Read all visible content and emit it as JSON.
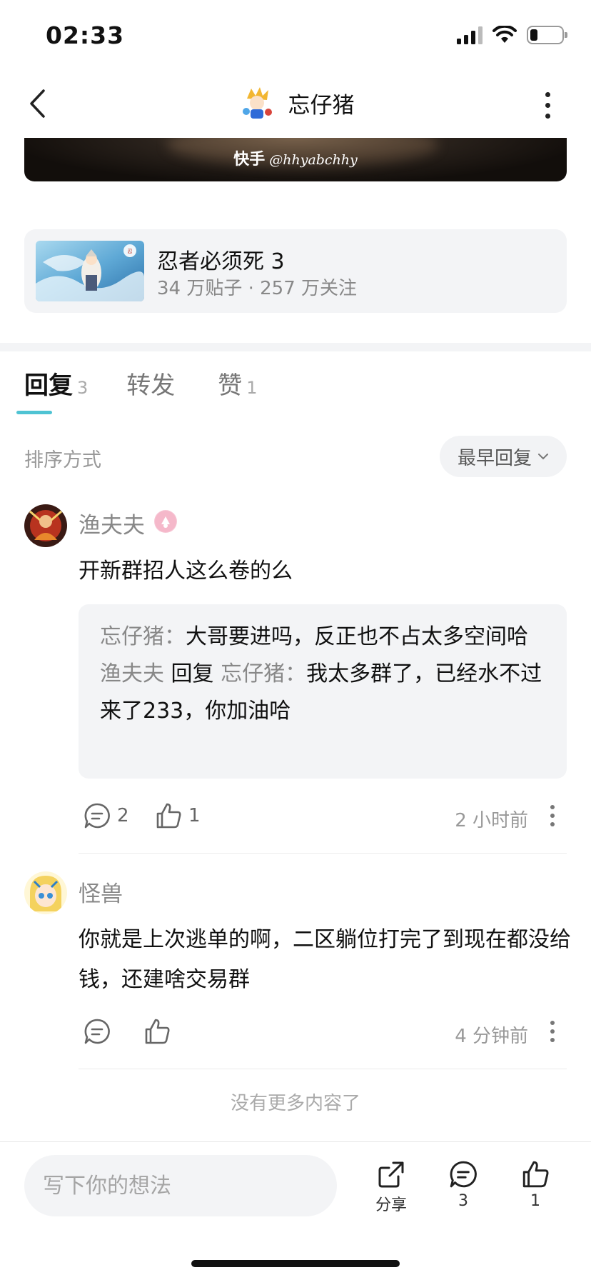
{
  "status_bar": {
    "time": "02:33"
  },
  "nav": {
    "title": "忘仔猪"
  },
  "media": {
    "watermark_brand": "快手",
    "watermark_handle": "@hhyabchhy"
  },
  "forum": {
    "name": "忍者必须死 3",
    "stats": "34 万贴子 · 257 万关注"
  },
  "tabs": [
    {
      "label": "回复",
      "count": "3",
      "active": true
    },
    {
      "label": "转发",
      "count": "",
      "active": false
    },
    {
      "label": "赞",
      "count": "1",
      "active": false
    }
  ],
  "sort": {
    "label": "排序方式",
    "selected": "最早回复"
  },
  "comments": [
    {
      "username": "渔夫夫",
      "text": "开新群招人这么卷的么",
      "replies": [
        {
          "author": "忘仔猪",
          "text": "大哥要进吗，反正也不占太多空间哈"
        },
        {
          "author": "渔夫夫",
          "reply_word": "回复",
          "reply_to": "忘仔猪",
          "text": "我太多群了，已经水不过来了233，你加油哈"
        }
      ],
      "reply_count": "2",
      "like_count": "1",
      "time": "2 小时前"
    },
    {
      "username": "怪兽",
      "text": "你就是上次逃单的啊，二区躺位打完了到现在都没给钱，还建啥交易群",
      "time": "4 分钟前"
    }
  ],
  "footer_text": "没有更多内容了",
  "bottom_bar": {
    "input_placeholder": "写下你的想法",
    "share_label": "分享",
    "comment_count": "3",
    "like_count": "1"
  },
  "colors": {
    "accent": "#4fc3d3",
    "card_bg": "#f3f4f6"
  }
}
